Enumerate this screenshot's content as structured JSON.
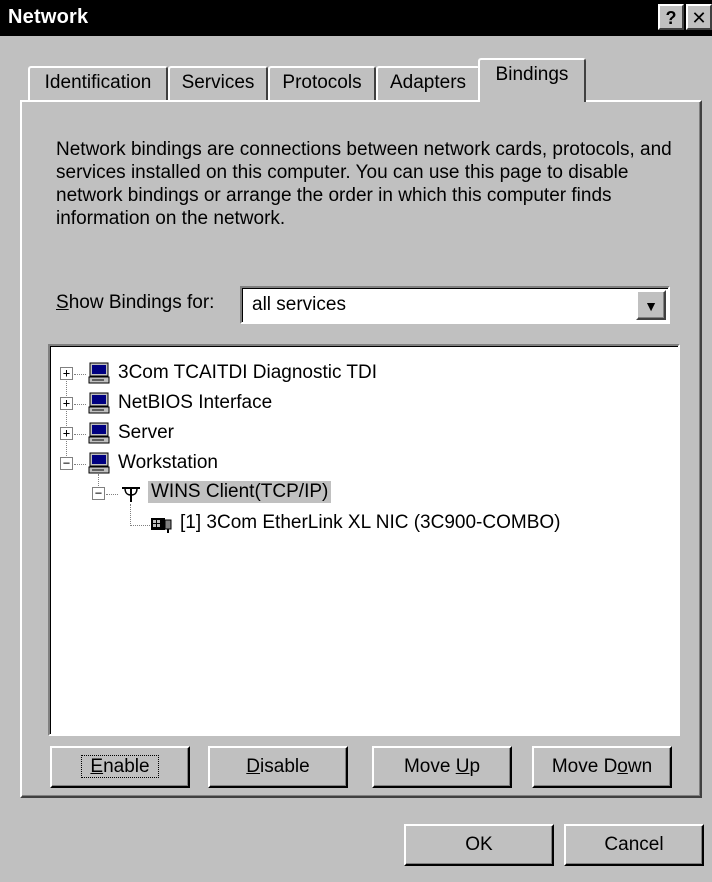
{
  "window": {
    "title": "Network",
    "help_glyph": "?",
    "close_glyph": "✕"
  },
  "tabs": [
    {
      "label": "Identification"
    },
    {
      "label": "Services"
    },
    {
      "label": "Protocols"
    },
    {
      "label": "Adapters"
    },
    {
      "label": "Bindings",
      "active": true
    }
  ],
  "description": "Network bindings are connections between network cards, protocols, and services installed on this computer.  You can use this page to disable network bindings or arrange the order in which this computer finds information on the network.",
  "show_bindings": {
    "label_accel": "S",
    "label_rest": "how Bindings for:",
    "value": "all services",
    "dropdown_glyph": "▼"
  },
  "tree": {
    "items": [
      {
        "label": "3Com TCAITDI Diagnostic TDI",
        "expander": "+"
      },
      {
        "label": "NetBIOS Interface",
        "expander": "+"
      },
      {
        "label": "Server",
        "expander": "+"
      },
      {
        "label": "Workstation",
        "expander": "−"
      },
      {
        "label": "WINS Client(TCP/IP)",
        "expander": "−"
      },
      {
        "label": "[1] 3Com EtherLink XL NIC (3C900-COMBO)"
      }
    ]
  },
  "buttons": {
    "enable": {
      "accel": "E",
      "rest": "nable"
    },
    "disable": {
      "accel": "D",
      "rest": "isable"
    },
    "move_up": {
      "pre": "Move ",
      "accel": "U",
      "rest": "p"
    },
    "move_down": {
      "pre": "Move D",
      "accel": "o",
      "rest": "wn"
    },
    "ok": "OK",
    "cancel": "Cancel"
  }
}
